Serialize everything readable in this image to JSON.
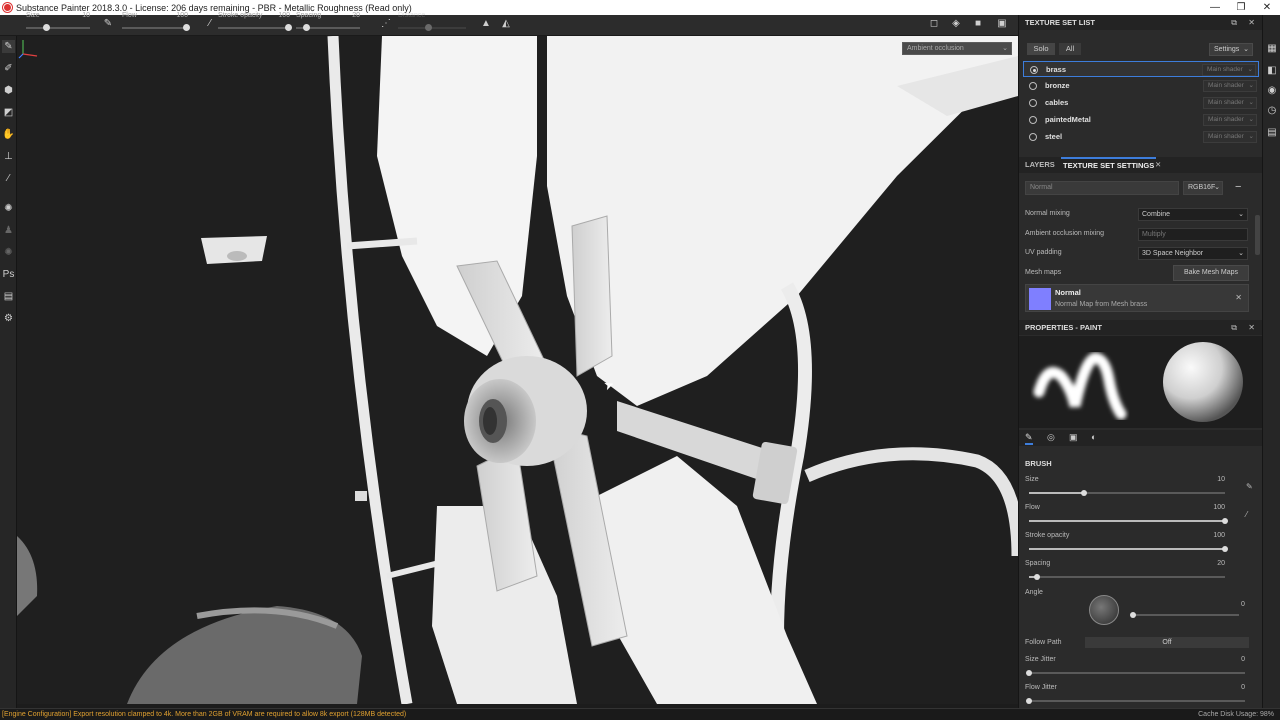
{
  "titlebar": {
    "title": "Substance Painter 2018.3.0 - License: 206 days remaining - PBR - Metallic Roughness (Read only)",
    "minimize": "—",
    "restore": "❐",
    "close": "✕"
  },
  "toolbar": {
    "size_label": "Size",
    "size_value": "10",
    "size_level": 0.1,
    "flow_label": "Flow",
    "flow_value": "100",
    "flow_level": 1.0,
    "opacity_label": "Stroke opacity",
    "opacity_value": "100",
    "opacity_level": 1.0,
    "spacing_label": "Spacing",
    "spacing_value": "20",
    "spacing_level": 0.2,
    "distance_label": "Distance"
  },
  "viewport": {
    "channel_select": "Ambient occlusion"
  },
  "statusbar": {
    "message": "[Engine Configuration] Export resolution clamped to 4k. More than 2GB of VRAM are required to allow 8k export (128MB detected)",
    "cache": "Cache Disk Usage:  98%"
  },
  "texture_set_list": {
    "title": "TEXTURE SET LIST",
    "solo_label": "Solo",
    "all_label": "All",
    "settings_label": "Settings",
    "items": [
      {
        "name": "brass",
        "shader": "Main shader",
        "selected": true
      },
      {
        "name": "bronze",
        "shader": "Main shader",
        "selected": false
      },
      {
        "name": "cables",
        "shader": "Main shader",
        "selected": false
      },
      {
        "name": "paintedMetal",
        "shader": "Main shader",
        "selected": false
      },
      {
        "name": "steel",
        "shader": "Main shader",
        "selected": false
      }
    ]
  },
  "tss": {
    "tab_layers": "LAYERS",
    "tab_settings": "TEXTURE SET SETTINGS",
    "channel_name": "Normal",
    "channel_format": "RGB16F",
    "normal_mixing_label": "Normal mixing",
    "normal_mixing_value": "Combine",
    "ao_mixing_label": "Ambient occlusion mixing",
    "ao_mixing_value": "Multiply",
    "uv_padding_label": "UV padding",
    "uv_padding_value": "3D Space Neighbor",
    "mesh_maps_label": "Mesh maps",
    "bake_button": "Bake Mesh Maps",
    "mesh_map_name": "Normal",
    "mesh_map_desc": "Normal Map from Mesh brass"
  },
  "properties": {
    "title": "PROPERTIES - PAINT",
    "brush_header": "BRUSH",
    "size_label": "Size",
    "size_value": "10",
    "size_level": 0.28,
    "flow_label": "Flow",
    "flow_value": "100",
    "flow_level": 1.0,
    "opacity_label": "Stroke opacity",
    "opacity_value": "100",
    "opacity_level": 1.0,
    "spacing_label": "Spacing",
    "spacing_value": "20",
    "spacing_level": 0.04,
    "angle_label": "Angle",
    "angle_value": "0",
    "follow_path_label": "Follow Path",
    "follow_path_value": "Off",
    "size_jitter_label": "Size Jitter",
    "size_jitter_value": "0",
    "flow_jitter_label": "Flow Jitter",
    "flow_jitter_value": "0"
  },
  "colors": {
    "accent_blue": "#3d7ddb",
    "normal_swatch": "#7f7fff",
    "status_warning": "#e0a030"
  }
}
